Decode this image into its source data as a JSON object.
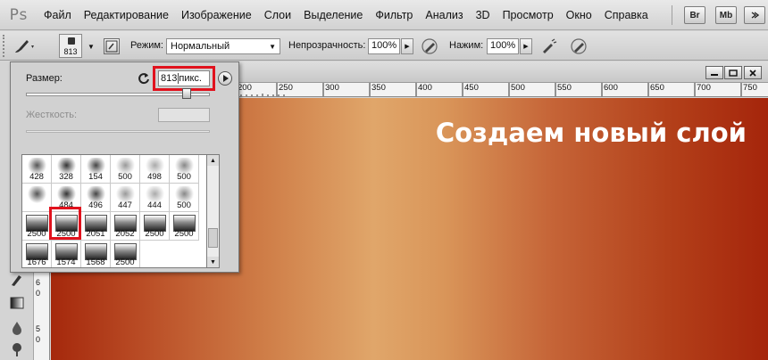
{
  "app": {
    "logo": "Ps"
  },
  "menu": [
    "Файл",
    "Редактирование",
    "Изображение",
    "Слои",
    "Выделение",
    "Фильтр",
    "Анализ",
    "3D",
    "Просмотр",
    "Окно",
    "Справка"
  ],
  "bridge": {
    "br_label": "Br",
    "mb_label": "Mb"
  },
  "options": {
    "brush_size": "813",
    "mode_label": "Режим:",
    "mode_value": "Нормальный",
    "opacity_label": "Непрозрачность:",
    "opacity_value": "100%",
    "flow_label": "Нажим:",
    "flow_value": "100%"
  },
  "document": {
    "ruler_marks": [
      "200",
      "250",
      "300",
      "350",
      "400",
      "450",
      "500",
      "550",
      "600",
      "650",
      "700",
      "750"
    ],
    "vertical_marks": [
      "6",
      "5",
      "0"
    ]
  },
  "canvas": {
    "caption": "Создаем новый слой"
  },
  "brush_picker": {
    "size_label": "Размер:",
    "size_value": "813",
    "size_unit": "пикс.",
    "hardness_label": "Жесткость:",
    "brushes": [
      "428",
      "328",
      "154",
      "500",
      "498",
      "500",
      "",
      "484",
      "496",
      "447",
      "444",
      "500",
      "2500",
      "2500",
      "2051",
      "2052",
      "2500",
      "2500",
      "1676",
      "1574",
      "1568",
      "2500"
    ],
    "selected_brush_index": 13
  },
  "colors": {
    "highlight": "#e1121d",
    "caption": "#ffffff"
  }
}
